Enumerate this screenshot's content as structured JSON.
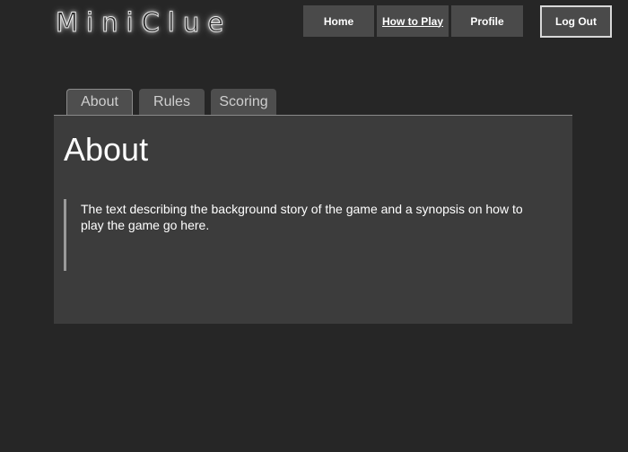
{
  "header": {
    "logo_text": "MiniClue",
    "nav": {
      "home_label": "Home",
      "how_to_play_label": "How to Play",
      "profile_label": "Profile"
    },
    "logout_label": "Log Out"
  },
  "tabs": [
    {
      "label": "About",
      "active": true
    },
    {
      "label": "Rules",
      "active": false
    },
    {
      "label": "Scoring",
      "active": false
    }
  ],
  "content": {
    "title": "About",
    "description": " The text describing the background story of the game and a synopsis on how to play the game go here."
  },
  "colors": {
    "background": "#262626",
    "nav_button": "#4a4a4a",
    "panel": "#3c3c3c",
    "tab": "#4e4e4e"
  }
}
